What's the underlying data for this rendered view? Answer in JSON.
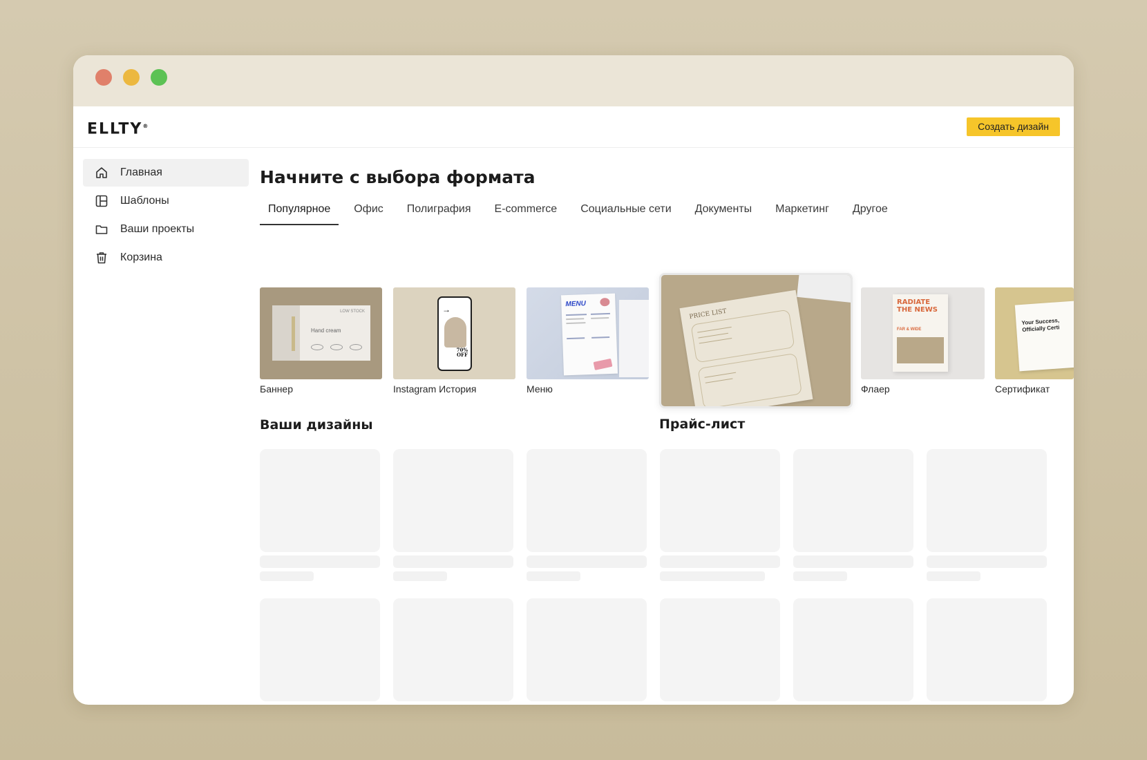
{
  "brand": {
    "logo_text": "ELLTY"
  },
  "header": {
    "create_button": "Создать дизайн"
  },
  "sidebar": {
    "items": [
      {
        "label": "Главная",
        "icon": "home-icon",
        "active": true
      },
      {
        "label": "Шаблоны",
        "icon": "templates-icon",
        "active": false
      },
      {
        "label": "Ваши проекты",
        "icon": "folder-icon",
        "active": false
      },
      {
        "label": "Корзина",
        "icon": "trash-icon",
        "active": false
      }
    ]
  },
  "main": {
    "title": "Начните с выбора формата",
    "tabs": [
      {
        "label": "Популярное",
        "active": true
      },
      {
        "label": "Офис"
      },
      {
        "label": "Полиграфия"
      },
      {
        "label": "E-commerce"
      },
      {
        "label": "Социальные сети"
      },
      {
        "label": "Документы"
      },
      {
        "label": "Маркетинг"
      },
      {
        "label": "Другое"
      }
    ],
    "formats": [
      {
        "label": "Баннер",
        "thumb_text": "LOW STOCK",
        "thumb_sub": "Hand cream"
      },
      {
        "label": "Instagram История",
        "thumb_text": "70% OFF"
      },
      {
        "label": "Меню",
        "thumb_text": "MENU"
      },
      {
        "label": "Прайс-лист",
        "thumb_text": "PRICE LIST",
        "featured": true
      },
      {
        "label": "Флаер",
        "thumb_text": "RADIATE THE NEWS",
        "thumb_sub": "FAR & WIDE"
      },
      {
        "label": "Сертификат",
        "thumb_text": "Your Success, Officially Certi"
      }
    ],
    "designs_title": "Ваши дизайны"
  },
  "colors": {
    "accent": "#f6c52a",
    "background": "#c8bb9b",
    "titlebar": "#ebe5d7"
  }
}
